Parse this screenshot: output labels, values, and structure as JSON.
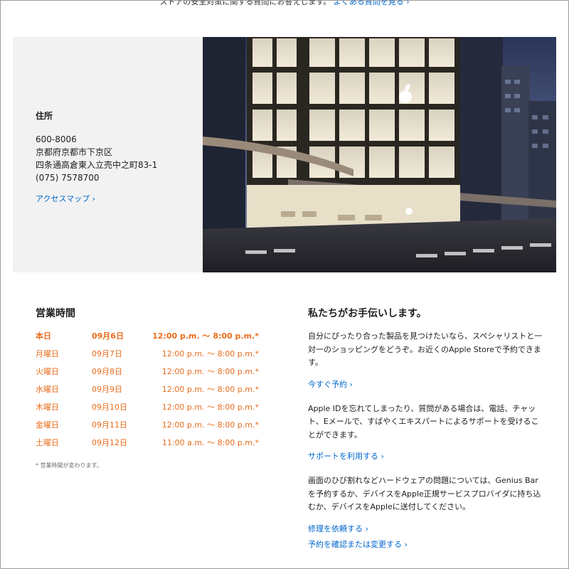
{
  "top_note": {
    "text": "ストアの安全対策に関する質問にお答えします。",
    "link": "よくある質問を見る ›"
  },
  "store": {
    "address_heading": "住所",
    "postal_code": "600-8006",
    "city": "京都府京都市下京区",
    "street": "四条通高倉東入立売中之町83-1",
    "phone": "(075) 7578700",
    "map_link": "アクセスマップ ›"
  },
  "hours": {
    "heading": "営業時間",
    "rows": [
      {
        "day": "本日",
        "date": "09月6日",
        "time": "12:00 p.m. ～ 8:00 p.m.*"
      },
      {
        "day": "月曜日",
        "date": "09月7日",
        "time": "12:00 p.m. ～ 8:00 p.m.*"
      },
      {
        "day": "火曜日",
        "date": "09月8日",
        "time": "12:00 p.m. ～ 8:00 p.m.*"
      },
      {
        "day": "水曜日",
        "date": "09月9日",
        "time": "12:00 p.m. ～ 8:00 p.m.*"
      },
      {
        "day": "木曜日",
        "date": "09月10日",
        "time": "12:00 p.m. ～ 8:00 p.m.*"
      },
      {
        "day": "金曜日",
        "date": "09月11日",
        "time": "12:00 p.m. ～ 8:00 p.m.*"
      },
      {
        "day": "土曜日",
        "date": "09月12日",
        "time": "11:00 a.m. ～ 8:00 p.m.*"
      }
    ],
    "note": "* 営業時間が変わります。"
  },
  "help": {
    "heading": "私たちがお手伝いします。",
    "paragraph1": "自分にぴったり合った製品を見つけたいなら、スペシャリストと一対一のショッピングをどうぞ。お近くのApple Storeで予約できます。",
    "link1": "今すぐ予約 ›",
    "paragraph2": "Apple IDを忘れてしまったり、質問がある場合は、電話、チャット、Eメールで、すばやくエキスパートによるサポートを受けることができます。",
    "link2": "サポートを利用する ›",
    "paragraph3": "画面のひび割れなどハードウェアの問題については、Genius Barを予約するか、デバイスをApple正規サービスプロバイダに持ち込むか、デバイスをAppleに送付してください。",
    "link3": "修理を依頼する ›",
    "link4": "予約を確認または変更する ›"
  },
  "colors": {
    "link": "#0066cc",
    "hours_accent": "#e86c1b",
    "card_background": "#f2f2f2"
  }
}
